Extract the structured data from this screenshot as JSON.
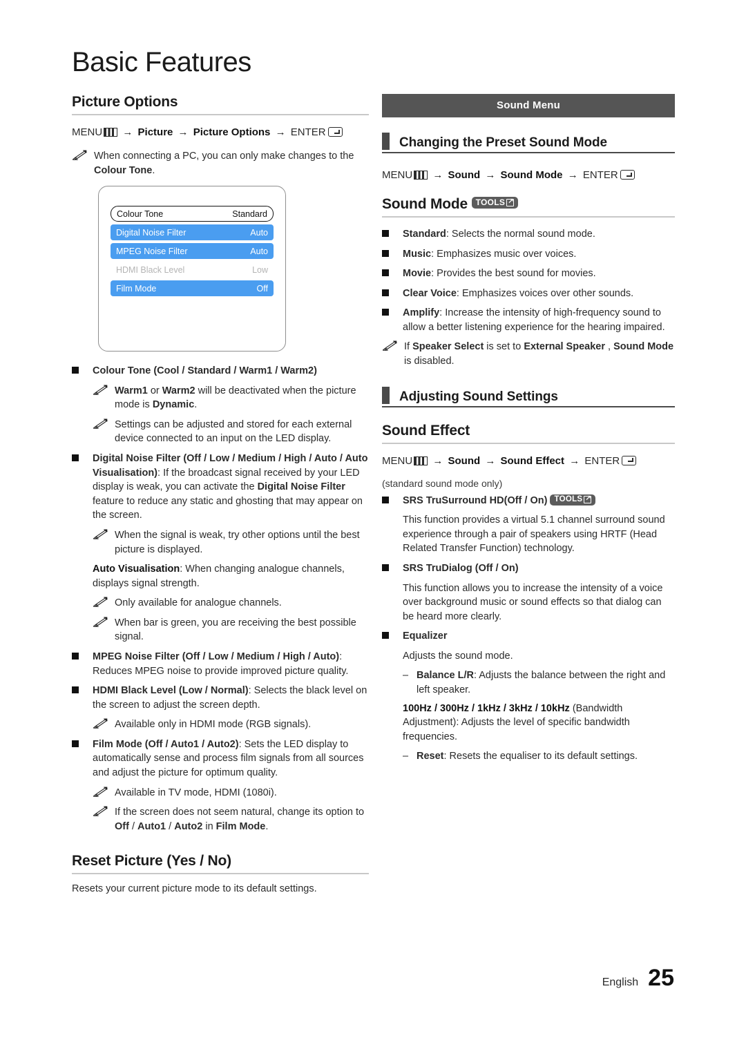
{
  "page": {
    "title": "Basic Features",
    "footer_language": "English",
    "footer_page_number": "25"
  },
  "colors": {
    "osd_highlight": "#4a9df0",
    "banner_bg": "#555555",
    "section_bar": "#4a4a4a"
  },
  "left_column": {
    "heading": "Picture Options",
    "path": {
      "menu_label": "MENU",
      "menu_icon": "menu-icon",
      "arrow": "→",
      "step1": "Picture",
      "step2": "Picture Options",
      "enter_label": "ENTER",
      "enter_icon": "enter-icon"
    },
    "intro_note": {
      "icon": "pencil-note-icon",
      "text_1": "When connecting a PC, you can only make changes to the ",
      "bold_1": "Colour Tone",
      "text_2": "."
    },
    "osd": {
      "rows": [
        {
          "label": "Colour Tone",
          "value": "Standard",
          "style": "frame"
        },
        {
          "label": "Digital Noise Filter",
          "value": "Auto",
          "style": "highlighted"
        },
        {
          "label": "MPEG Noise Filter",
          "value": "Auto",
          "style": "highlighted"
        },
        {
          "label": "HDMI Black Level",
          "value": "Low",
          "style": "dimmed"
        },
        {
          "label": "Film Mode",
          "value": "Off",
          "style": "highlighted"
        }
      ]
    },
    "items": {
      "colour_tone_title": "Colour Tone (Cool / Standard / Warm1 / Warm2)",
      "colour_tone_note1_a": "Warm1",
      "colour_tone_note1_b": " or ",
      "colour_tone_note1_c": "Warm2",
      "colour_tone_note1_d": " will be deactivated when the picture mode is ",
      "colour_tone_note1_e": "Dynamic",
      "colour_tone_note1_f": ".",
      "colour_tone_note2": "Settings can be adjusted and stored for each external device connected to an input on the LED display.",
      "dnf_title": "Digital Noise Filter (Off / Low / Medium / High / Auto / Auto Visualisation)",
      "dnf_body_1": ": If the broadcast signal received by your LED display is weak, you can activate the ",
      "dnf_body_bold": "Digital Noise Filter",
      "dnf_body_2": " feature to reduce any static and ghosting that may appear on the screen.",
      "dnf_note": "When the signal is weak, try other options until the best picture is displayed.",
      "auto_vis_bold": "Auto Visualisation",
      "auto_vis_text": ": When changing analogue channels, displays signal strength.",
      "auto_vis_note1": "Only available for analogue channels.",
      "auto_vis_note2": "When bar is green, you are receiving the best possible signal.",
      "mpeg_title": "MPEG Noise Filter (Off / Low / Medium / High / Auto)",
      "mpeg_body": ": Reduces MPEG noise to provide improved picture quality.",
      "hdmi_title": "HDMI Black Level (Low / Normal)",
      "hdmi_body": ": Selects the black level on the screen to adjust the screen depth.",
      "hdmi_note": "Available only in HDMI mode (RGB signals).",
      "film_title": "Film Mode (Off / Auto1 / Auto2)",
      "film_body": ": Sets the LED display to automatically sense and process film signals from all sources and adjust the picture for optimum quality.",
      "film_note1": "Available in TV mode, HDMI (1080i).",
      "film_note2_a": "If the screen does not seem natural, change its option to ",
      "film_note2_b": "Off",
      "film_note2_c": " / ",
      "film_note2_d": "Auto1",
      "film_note2_e": " / ",
      "film_note2_f": "Auto2",
      "film_note2_g": " in ",
      "film_note2_h": "Film Mode",
      "film_note2_i": "."
    },
    "reset": {
      "heading": "Reset Picture (Yes / No)",
      "body": "Resets your current picture mode to its default settings."
    }
  },
  "right_column": {
    "banner": "Sound Menu",
    "section_1": {
      "title": "Changing the Preset Sound Mode",
      "path": {
        "menu_label": "MENU",
        "arrow": "→",
        "step1": "Sound",
        "step2": "Sound Mode",
        "enter_label": "ENTER"
      },
      "heading": "Sound Mode",
      "tools_badge": "TOOLS",
      "modes": [
        {
          "name": "Standard",
          "desc": ": Selects the normal sound mode."
        },
        {
          "name": "Music",
          "desc": ": Emphasizes music over voices."
        },
        {
          "name": "Movie",
          "desc": ": Provides the best sound for movies."
        },
        {
          "name": "Clear Voice",
          "desc": ": Emphasizes voices over other sounds."
        },
        {
          "name": "Amplify",
          "desc": ": Increase the intensity of high-frequency sound to allow a better listening experience for the hearing impaired."
        }
      ],
      "note_a": "If ",
      "note_b": "Speaker Select",
      "note_c": " is set to ",
      "note_d": "External Speaker",
      "note_e": " , ",
      "note_f": "Sound Mode",
      "note_g": " is disabled."
    },
    "section_2": {
      "title": "Adjusting Sound Settings",
      "heading": "Sound Effect",
      "path": {
        "menu_label": "MENU",
        "arrow": "→",
        "step1": "Sound",
        "step2": "Sound Effect",
        "enter_label": "ENTER"
      },
      "subnote": "(standard sound mode only)",
      "srs_trusurround_title": "SRS TruSurround HD(Off / On)",
      "srs_trusurround_badge": "TOOLS",
      "srs_trusurround_body": "This function provides a virtual 5.1 channel surround sound experience through a pair of speakers using HRTF (Head Related Transfer Function) technology.",
      "srs_trudialog_title": "SRS TruDialog (Off / On)",
      "srs_trudialog_body": "This function allows you to increase the intensity of a voice over background music or sound effects so that dialog can be heard more clearly.",
      "equalizer_title": "Equalizer",
      "equalizer_body": "Adjusts the sound mode.",
      "balance_bold": "Balance L/R",
      "balance_text": ": Adjusts the balance between the right and left speaker.",
      "bandwidth_bold": "100Hz / 300Hz / 1kHz / 3kHz / 10kHz",
      "bandwidth_text": " (Bandwidth Adjustment): Adjusts the level of specific bandwidth frequencies.",
      "reset_bold": "Reset",
      "reset_text": ": Resets the equaliser to its default settings."
    }
  }
}
